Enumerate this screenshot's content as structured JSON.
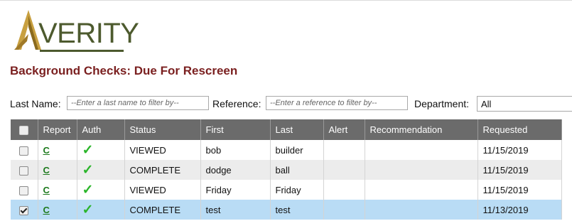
{
  "logo": {
    "text": "VERITY"
  },
  "page": {
    "title": "Background Checks: Due For Rescreen"
  },
  "filters": {
    "last_name_label": "Last Name:",
    "last_name_placeholder": "--Enter a last name to filter by--",
    "reference_label": "Reference:",
    "reference_placeholder": "--Enter a reference to filter by--",
    "department_label": "Department:",
    "department_selected": "All"
  },
  "table": {
    "headers": [
      "Report",
      "Auth",
      "Status",
      "First",
      "Last",
      "Alert",
      "Recommendation",
      "Requested"
    ],
    "rows": [
      {
        "checked": false,
        "report": "C",
        "auth": "✓",
        "status": "VIEWED",
        "first": "bob",
        "last": "builder",
        "alert": "",
        "recommendation": "",
        "requested": "11/15/2019"
      },
      {
        "checked": false,
        "report": "C",
        "auth": "✓",
        "status": "COMPLETE",
        "first": "dodge",
        "last": "ball",
        "alert": "",
        "recommendation": "",
        "requested": "11/15/2019"
      },
      {
        "checked": false,
        "report": "C",
        "auth": "✓",
        "status": "VIEWED",
        "first": "Friday",
        "last": "Friday",
        "alert": "",
        "recommendation": "",
        "requested": "11/15/2019"
      },
      {
        "checked": true,
        "report": "C",
        "auth": "✓",
        "status": "COMPLETE",
        "first": "test",
        "last": "test",
        "alert": "",
        "recommendation": "",
        "requested": "11/13/2019"
      }
    ]
  },
  "colors": {
    "title": "#7a1f1f",
    "logo": "#4d5a2e",
    "logo_gold": "#c8a040",
    "header_bg": "#6b6b6b",
    "selected_row": "#b9dcf5",
    "report_link": "#1e7a1e",
    "auth_check": "#2ab52a"
  },
  "icons": {
    "auth": "check-mark-icon",
    "logo": "verity-logo-chevron"
  }
}
